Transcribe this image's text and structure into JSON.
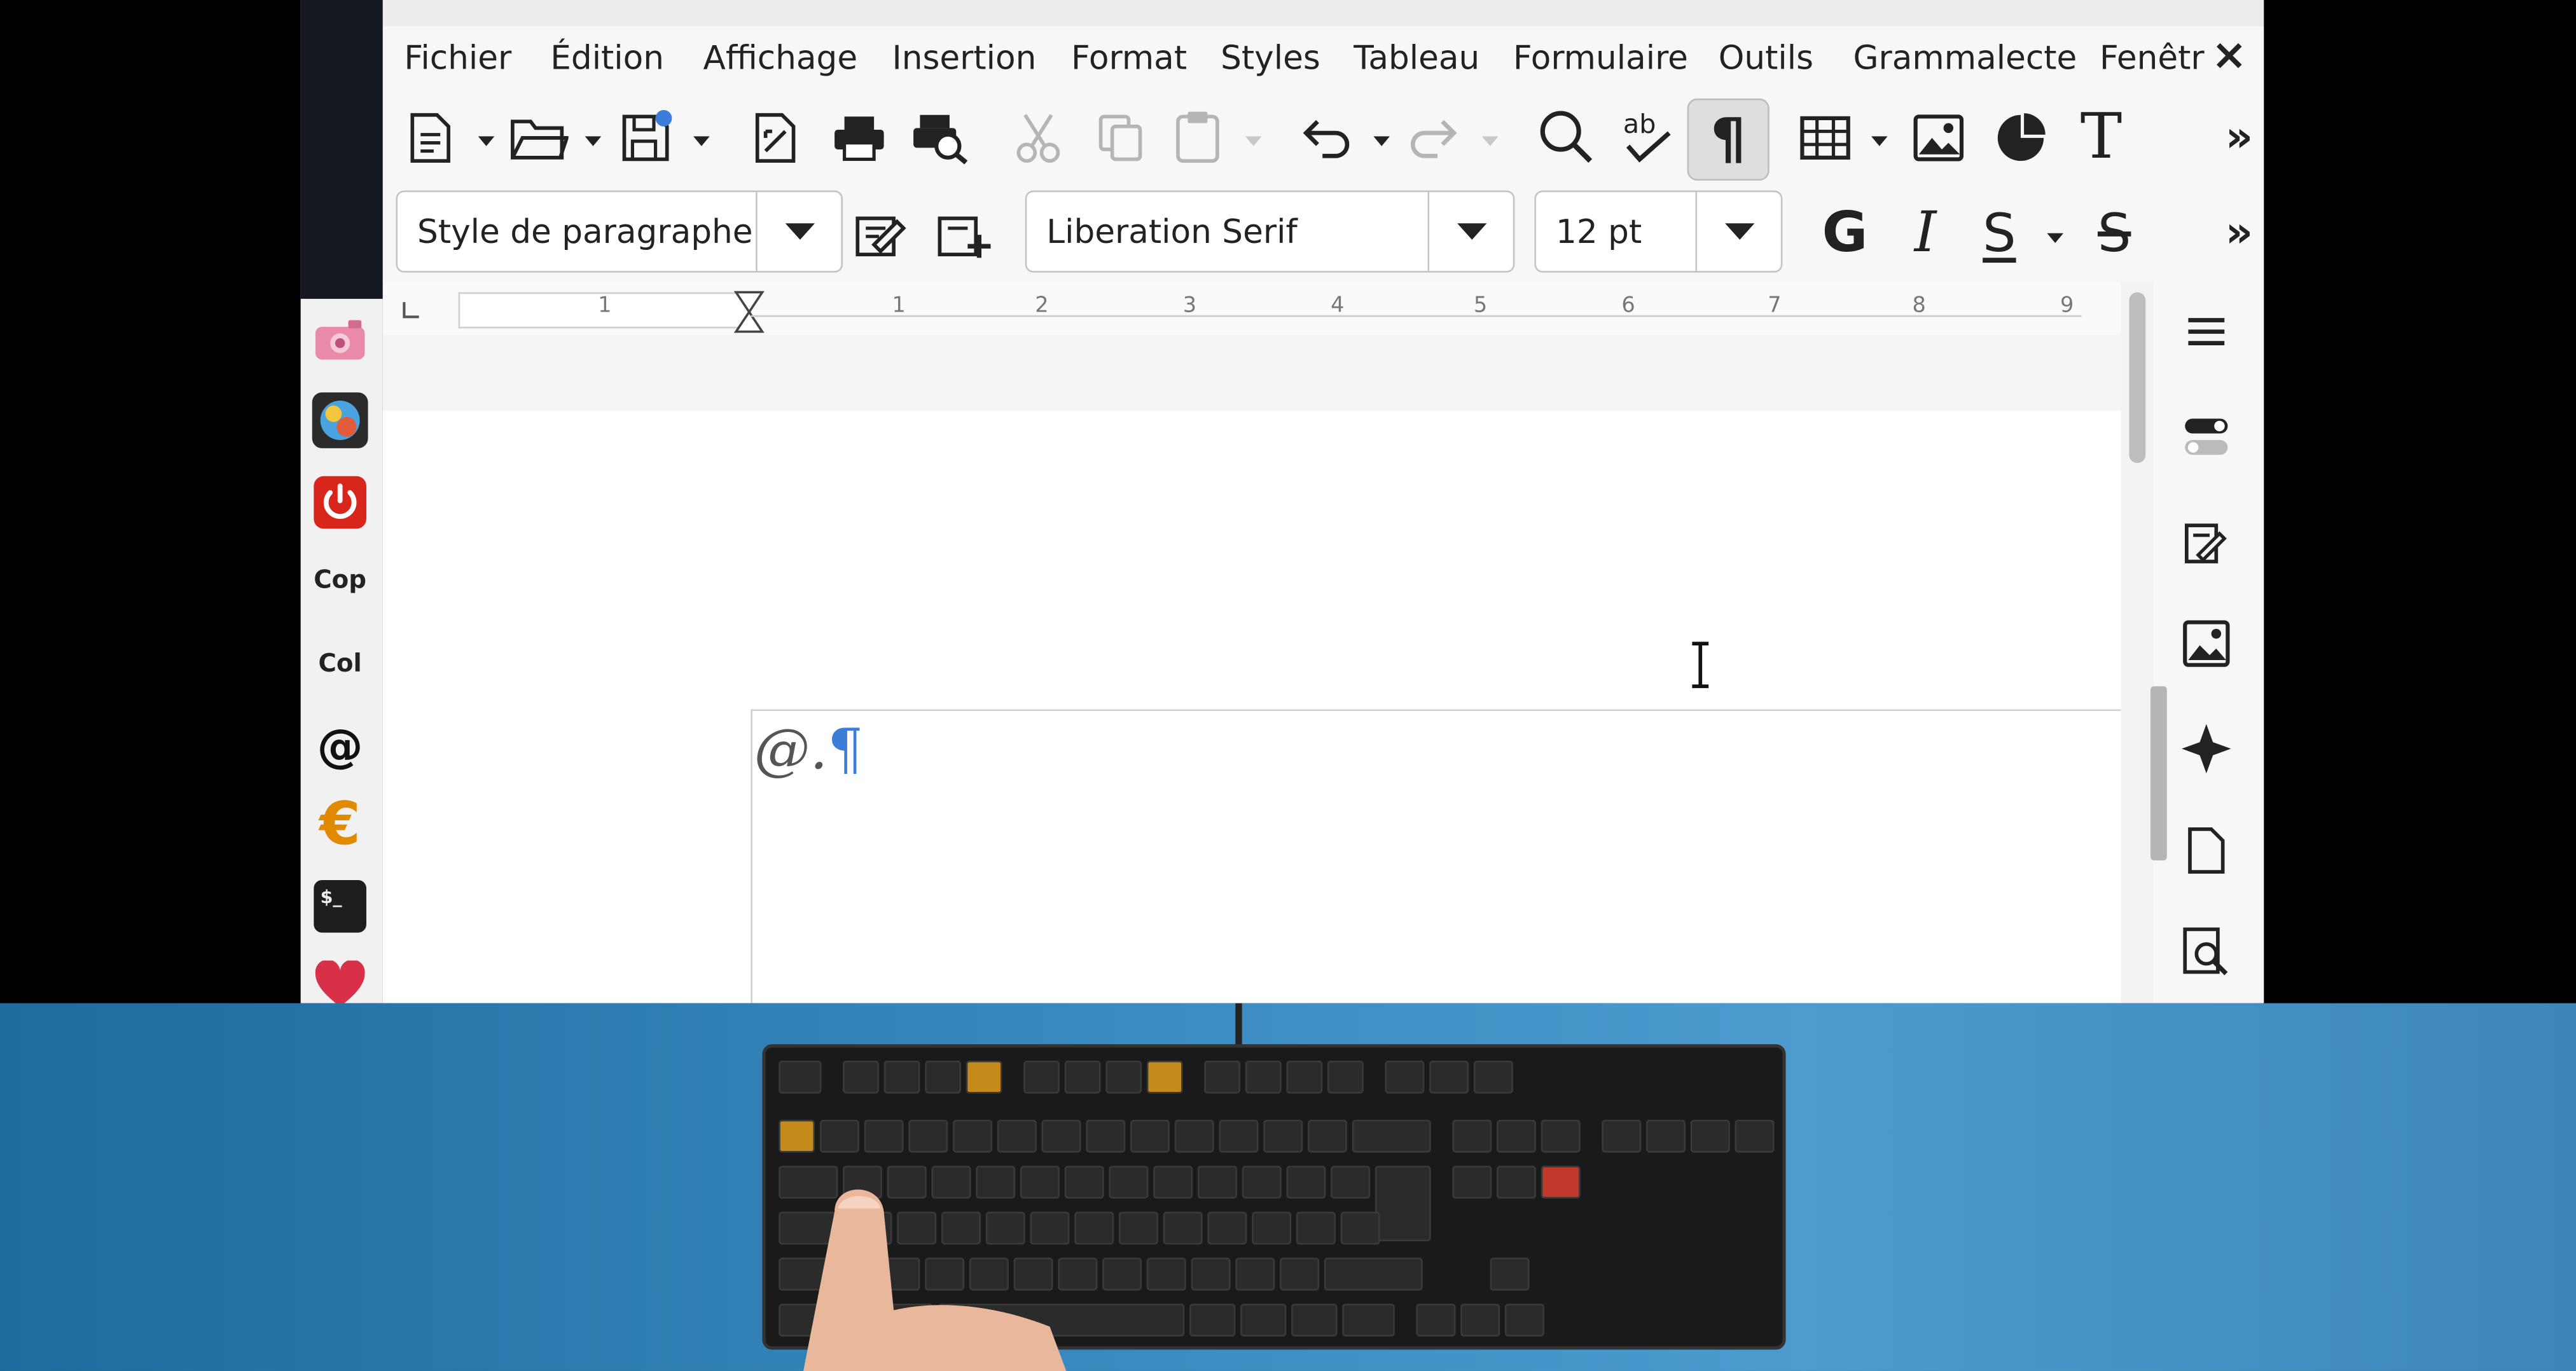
{
  "menubar": {
    "items": [
      "Fichier",
      "Édition",
      "Affichage",
      "Insertion",
      "Format",
      "Styles",
      "Tableau",
      "Formulaire",
      "Outils",
      "Grammalecte",
      "Fenêtr"
    ],
    "close_symbol": "×"
  },
  "toolbar": {
    "more_symbol": "»"
  },
  "formatting": {
    "paragraph_style": "Style de paragraphe",
    "font_name": "Liberation Serif",
    "font_size": "12 pt",
    "bold_label": "G",
    "italic_label": "I",
    "underline_label": "S",
    "strike_label": "S"
  },
  "ruler": {
    "labels": [
      "1",
      "1",
      "2",
      "3",
      "4",
      "5",
      "6",
      "7",
      "8",
      "9"
    ]
  },
  "document": {
    "content": "@.",
    "pilcrow": "¶"
  },
  "dock": {
    "copy_label": "Cop",
    "paste_label": "Col",
    "at_label": "@",
    "euro_label": "€",
    "terminal_label": "$_"
  },
  "colors": {
    "accent": "#3b7dd8",
    "power": "#d9261c",
    "euro": "#e08a00",
    "desk": "#3b8cc2"
  }
}
